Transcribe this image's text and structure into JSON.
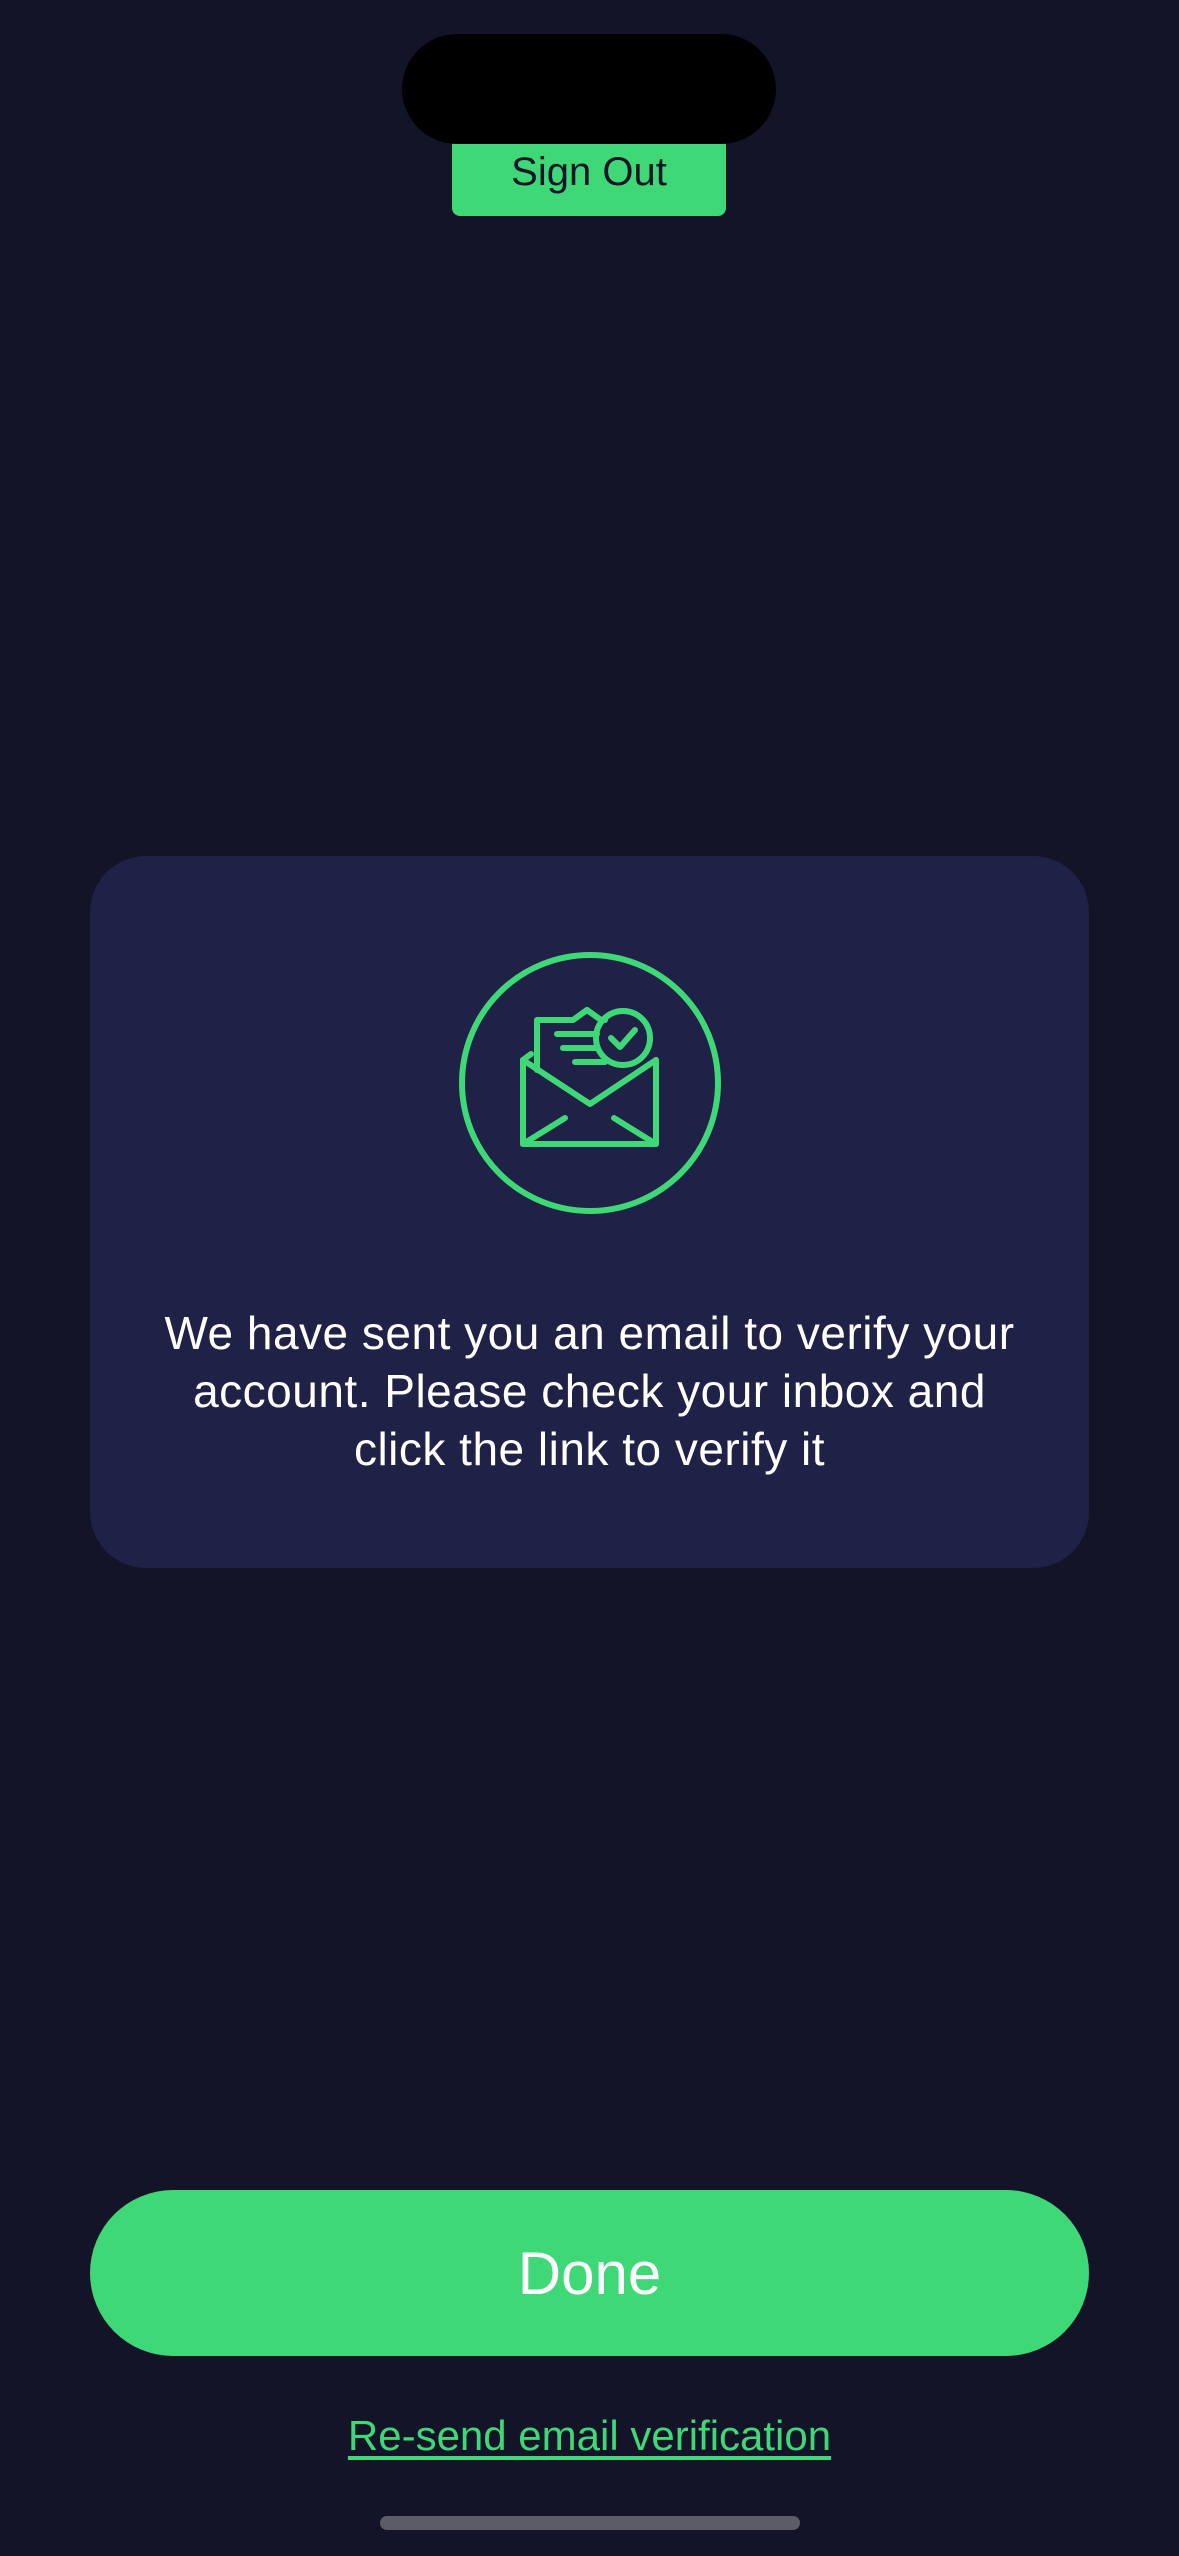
{
  "header": {
    "sign_out_label": "Sign Out"
  },
  "card": {
    "icon": "email-verified-icon",
    "message": "We have sent you an email to verify your account. Please check your inbox and click the link to verify it"
  },
  "actions": {
    "done_label": "Done",
    "resend_label": "Re-send email verification"
  },
  "colors": {
    "background": "#141428",
    "card": "#1f2146",
    "accent": "#3fd877",
    "text": "#ffffff"
  }
}
